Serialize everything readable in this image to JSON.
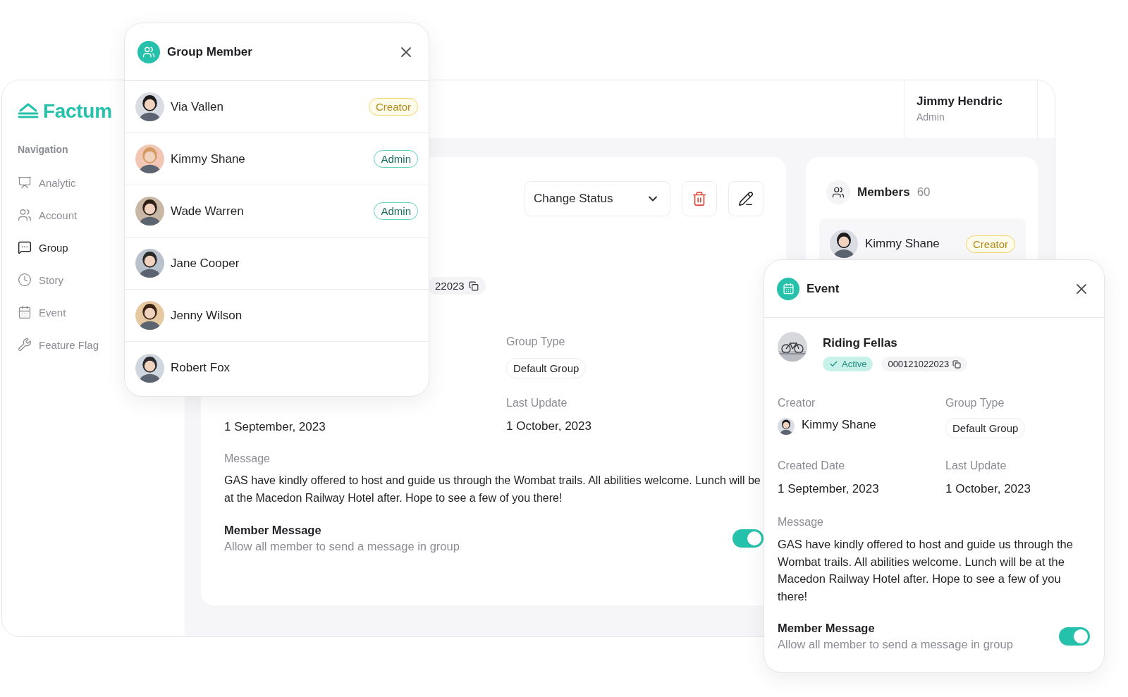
{
  "sidebar": {
    "logo": "Factum",
    "section": "Navigation",
    "items": [
      {
        "label": "Analytic",
        "selected": false
      },
      {
        "label": "Account",
        "selected": false
      },
      {
        "label": "Group",
        "selected": true
      },
      {
        "label": "Story",
        "selected": false
      },
      {
        "label": "Event",
        "selected": false
      },
      {
        "label": "Feature Flag",
        "selected": false
      }
    ]
  },
  "header": {
    "user_name": "Jimmy Hendric",
    "user_role": "Admin"
  },
  "group_detail": {
    "status_dropdown": "Change Status",
    "id_chip": "22023",
    "group_type_label": "Group Type",
    "group_type": "Default Group",
    "created_date": "1 September, 2023",
    "last_update_label": "Last Update",
    "last_update": "1 October, 2023",
    "message_label": "Message",
    "message": "GAS have kindly offered to host and guide us through the Wombat trails. All abilities welcome. Lunch will be at the Macedon Railway Hotel after. Hope to see a few of you there!",
    "member_message": {
      "title": "Member Message",
      "description": "Allow all member to send a message in group",
      "on": true
    }
  },
  "members_card": {
    "title": "Members",
    "count": "60",
    "rows": [
      {
        "name": "Kimmy Shane",
        "role": "Creator",
        "kind": "creator"
      }
    ]
  },
  "group_member_panel": {
    "title": "Group Member",
    "members": [
      {
        "name": "Via Vallen",
        "role": "Creator",
        "kind": "creator"
      },
      {
        "name": "Kimmy Shane",
        "role": "Admin",
        "kind": "admin"
      },
      {
        "name": "Wade Warren",
        "role": "Admin",
        "kind": "admin"
      },
      {
        "name": "Jane Cooper"
      },
      {
        "name": "Jenny Wilson"
      },
      {
        "name": "Robert Fox"
      }
    ]
  },
  "event_panel": {
    "title": "Event",
    "name": "Riding Fellas",
    "status": "Active",
    "id_chip": "000121022023",
    "creator_label": "Creator",
    "creator": "Kimmy Shane",
    "group_type_label": "Group Type",
    "group_type": "Default Group",
    "created_label": "Created Date",
    "created_date": "1 September, 2023",
    "last_update_label": "Last Update",
    "last_update": "1 October, 2023",
    "message_label": "Message",
    "message": "GAS have kindly offered to host and guide us through the Wombat trails. All abilities welcome. Lunch will be at the Macedon Railway Hotel after. Hope to see a few of you there!",
    "member_message": {
      "title": "Member Message",
      "description": "Allow all member to send a message in group",
      "on": true
    }
  }
}
